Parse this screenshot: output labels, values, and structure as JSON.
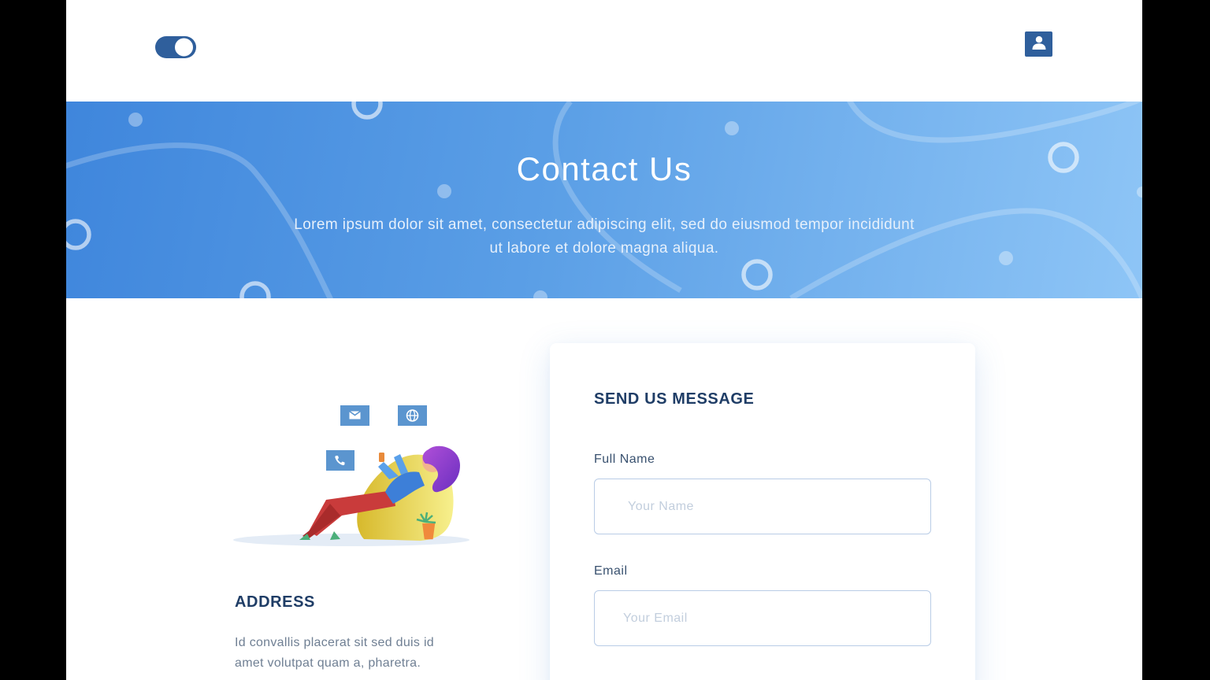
{
  "header": {
    "logo_icon": "toggle-logo",
    "user_icon": "user-profile-icon",
    "brand_color": "#2f5f9c"
  },
  "hero": {
    "title": "Contact Us",
    "subtitle": "Lorem ipsum dolor sit amet, consectetur adipiscing elit, sed do eiusmod tempor incididunt ut labore et dolore magna aliqua.",
    "gradient_start": "#3f86dc",
    "gradient_end": "#8ec5f6"
  },
  "illustration": {
    "icons": [
      "mail-icon",
      "globe-icon",
      "phone-icon"
    ],
    "tile_color": "#5b95cf"
  },
  "address": {
    "title": "ADDRESS",
    "text": "Id convallis placerat sit sed duis id amet volutpat quam a, pharetra."
  },
  "form": {
    "title": "SEND US MESSAGE",
    "full_name_label": "Full Name",
    "full_name_placeholder": "Your Name",
    "email_label": "Email",
    "email_placeholder": "Your Email"
  }
}
